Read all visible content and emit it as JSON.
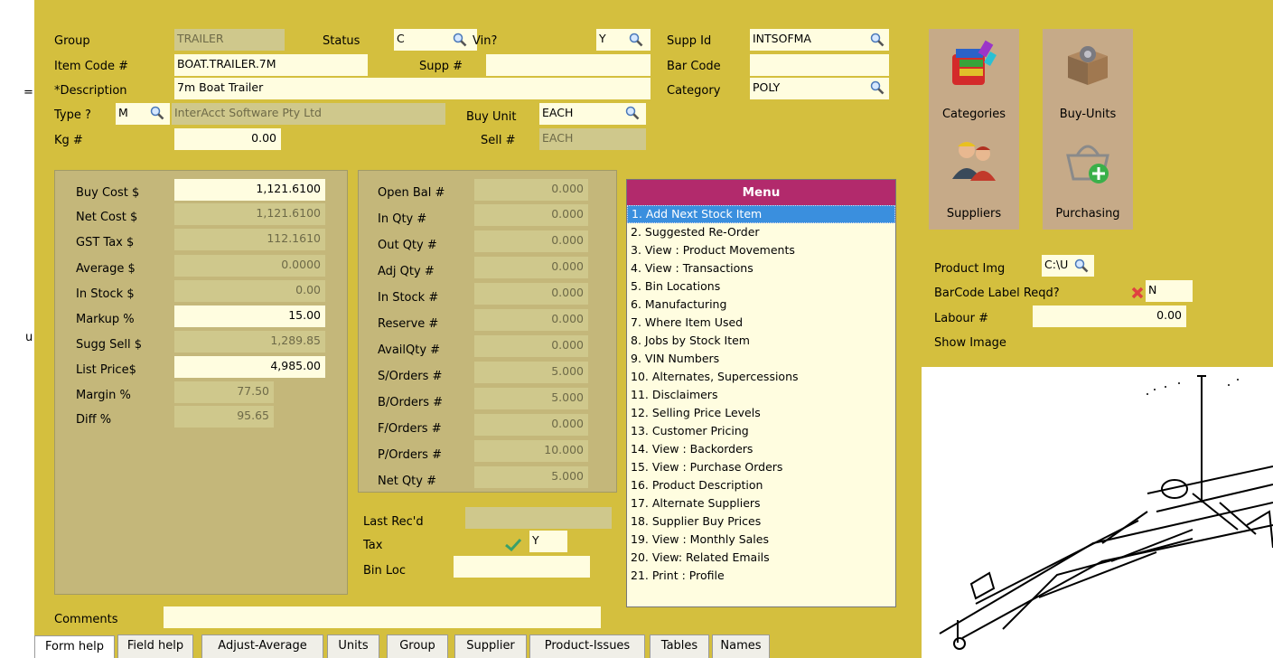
{
  "edge_glyphs": {
    "a": "=:",
    "b": "u"
  },
  "header": {
    "group_label": "Group",
    "group_value": "TRAILER",
    "status_label": "Status",
    "status_value": "C",
    "vin_label": "Vin?",
    "vin_value": "Y",
    "supp_id_label": "Supp Id",
    "supp_id_value": "INTSOFMA",
    "item_code_label": "Item Code #",
    "item_code_value": "BOAT.TRAILER.7M",
    "supp_label": "Supp #",
    "supp_value": "",
    "bar_code_label": "Bar Code",
    "bar_code_value": "",
    "description_label": "*Description",
    "description_value": "7m Boat Trailer",
    "category_label": "Category",
    "category_value": "POLY",
    "type_label": "Type ?",
    "type_value": "M",
    "supplier_name": "InterAcct Software Pty Ltd",
    "buy_unit_label": "Buy Unit",
    "buy_unit_value": "EACH",
    "kg_label": "Kg #",
    "kg_value": "0.00",
    "sell_label": "Sell #",
    "sell_value": "EACH"
  },
  "cost": {
    "buy_cost_label": "Buy Cost $",
    "buy_cost_value": "1,121.6100",
    "net_cost_label": "Net Cost  $",
    "net_cost_value": "1,121.6100",
    "gst_label": "GST Tax  $",
    "gst_value": "112.1610",
    "average_label": "Average  $",
    "average_value": "0.0000",
    "in_stock_label": "In Stock  $",
    "in_stock_value": "0.00",
    "markup_label": "Markup %",
    "markup_value": "15.00",
    "sugg_sell_label": "Sugg Sell $",
    "sugg_sell_value": "1,289.85",
    "list_price_label": "List Price$",
    "list_price_value": "4,985.00",
    "margin_label": "Margin %",
    "margin_value": "77.50",
    "diff_label": "Diff %",
    "diff_value": "95.65"
  },
  "qty": {
    "open_bal_label": "Open Bal #",
    "open_bal_value": "0.000",
    "in_qty_label": "In Qty  #",
    "in_qty_value": "0.000",
    "out_qty_label": "Out Qty  #",
    "out_qty_value": "0.000",
    "adj_qty_label": "Adj Qty  #",
    "adj_qty_value": "0.000",
    "in_stock_label": "In Stock #",
    "in_stock_value": "0.000",
    "reserve_label": "Reserve  #",
    "reserve_value": "0.000",
    "avail_label": "AvailQty #",
    "avail_value": "0.000",
    "s_orders_label": "S/Orders #",
    "s_orders_value": "5.000",
    "b_orders_label": "B/Orders #",
    "b_orders_value": "5.000",
    "f_orders_label": "F/Orders #",
    "f_orders_value": "0.000",
    "p_orders_label": "P/Orders #",
    "p_orders_value": "10.000",
    "net_qty_label": "Net Qty  #",
    "net_qty_value": "5.000"
  },
  "misc": {
    "last_recd_label": "Last Rec'd",
    "last_recd_value": "",
    "tax_label": "Tax",
    "tax_value": "Y",
    "bin_loc_label": "Bin Loc",
    "bin_loc_value": "",
    "comments_label": "Comments",
    "comments_value": ""
  },
  "menu": {
    "title": "Menu",
    "items": [
      "1. Add Next Stock Item",
      "2. Suggested Re-Order",
      "3. View : Product Movements",
      "4. View : Transactions",
      "5. Bin Locations",
      "6. Manufacturing",
      "7. Where Item Used",
      "8. Jobs by Stock Item",
      "9. VIN Numbers",
      "10. Alternates, Supercessions",
      "11. Disclaimers",
      "12. Selling Price Levels",
      "13. Customer Pricing",
      "14. View : Backorders",
      "15. View : Purchase Orders",
      "16. Product Description",
      "17. Alternate Suppliers",
      "18. Supplier Buy Prices",
      "19. View : Monthly Sales",
      "20. View: Related Emails",
      "21. Print : Profile"
    ]
  },
  "tiles": {
    "categories": "Categories",
    "buy_units": "Buy-Units",
    "suppliers": "Suppliers",
    "purchasing": "Purchasing"
  },
  "right": {
    "product_img_label": "Product Img",
    "product_img_value": "C:\\U",
    "barcode_label": "BarCode Label Reqd?",
    "barcode_value": "N",
    "labour_label": "Labour #",
    "labour_value": "0.00",
    "show_image_label": "Show Image"
  },
  "tabs": [
    "Form help",
    "Field help",
    "Adjust-Average",
    "Units",
    "Group",
    "Supplier",
    "Product-Issues",
    "Tables",
    "Names"
  ],
  "colors": {
    "background": "#d4bf3e",
    "field": "#fffde0",
    "menu_title": "#b22a6c",
    "menu_selected": "#3a8fde"
  }
}
